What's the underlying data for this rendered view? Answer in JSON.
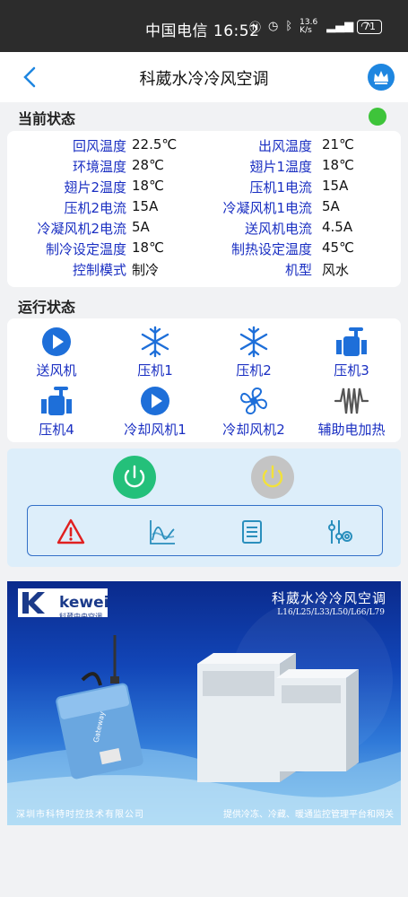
{
  "status_bar": {
    "carrier": "中国电信",
    "time": "16:52",
    "net_speed": "13.6 K/s",
    "battery": "71"
  },
  "header": {
    "title": "科葳水冷冷风空调",
    "back_icon": "chevron-left-icon",
    "vip_icon": "crown-icon"
  },
  "current_status": {
    "title": "当前状态",
    "indicator_color": "#3ec43a",
    "params": [
      {
        "label": "回风温度",
        "value": "22.5℃"
      },
      {
        "label": "出风温度",
        "value": "21℃"
      },
      {
        "label": "环境温度",
        "value": "28℃"
      },
      {
        "label": "翅片1温度",
        "value": "18℃"
      },
      {
        "label": "翅片2温度",
        "value": "18℃"
      },
      {
        "label": "压机1电流",
        "value": "15A"
      },
      {
        "label": "压机2电流",
        "value": "15A"
      },
      {
        "label": "冷凝风机1电流",
        "value": "5A"
      },
      {
        "label": "冷凝风机2电流",
        "value": "5A"
      },
      {
        "label": "送风机电流",
        "value": "4.5A"
      },
      {
        "label": "制冷设定温度",
        "value": "18℃"
      },
      {
        "label": "制热设定温度",
        "value": "45℃"
      },
      {
        "label": "控制模式",
        "value": "制冷"
      },
      {
        "label": "机型",
        "value": "风水"
      }
    ]
  },
  "run_status": {
    "title": "运行状态",
    "items": [
      {
        "label": "送风机",
        "icon": "play-circle-icon"
      },
      {
        "label": "压机1",
        "icon": "snowflake-icon"
      },
      {
        "label": "压机2",
        "icon": "snowflake-icon"
      },
      {
        "label": "压机3",
        "icon": "valve-icon"
      },
      {
        "label": "压机4",
        "icon": "valve-icon"
      },
      {
        "label": "冷却风机1",
        "icon": "play-circle-icon"
      },
      {
        "label": "冷却风机2",
        "icon": "fan-icon"
      },
      {
        "label": "辅助电加热",
        "icon": "heater-coil-icon"
      }
    ]
  },
  "controls": {
    "power_on_icon": "power-on-icon",
    "power_off_icon": "power-off-icon",
    "tools": [
      "alarm-warning-icon",
      "curve-chart-icon",
      "list-icon",
      "settings-sliders-icon"
    ]
  },
  "banner": {
    "brand": "kewei",
    "brand_sub": "科葳中央空调",
    "title": "科葳水冷冷风空调",
    "models": "L16/L25/L33/L50/L66/L79",
    "gateway_text": "Gateway",
    "footer_left": "深圳市科特时控技术有限公司",
    "footer_right": "提供冷冻、冷藏、暖通监控管理平台和网关"
  }
}
